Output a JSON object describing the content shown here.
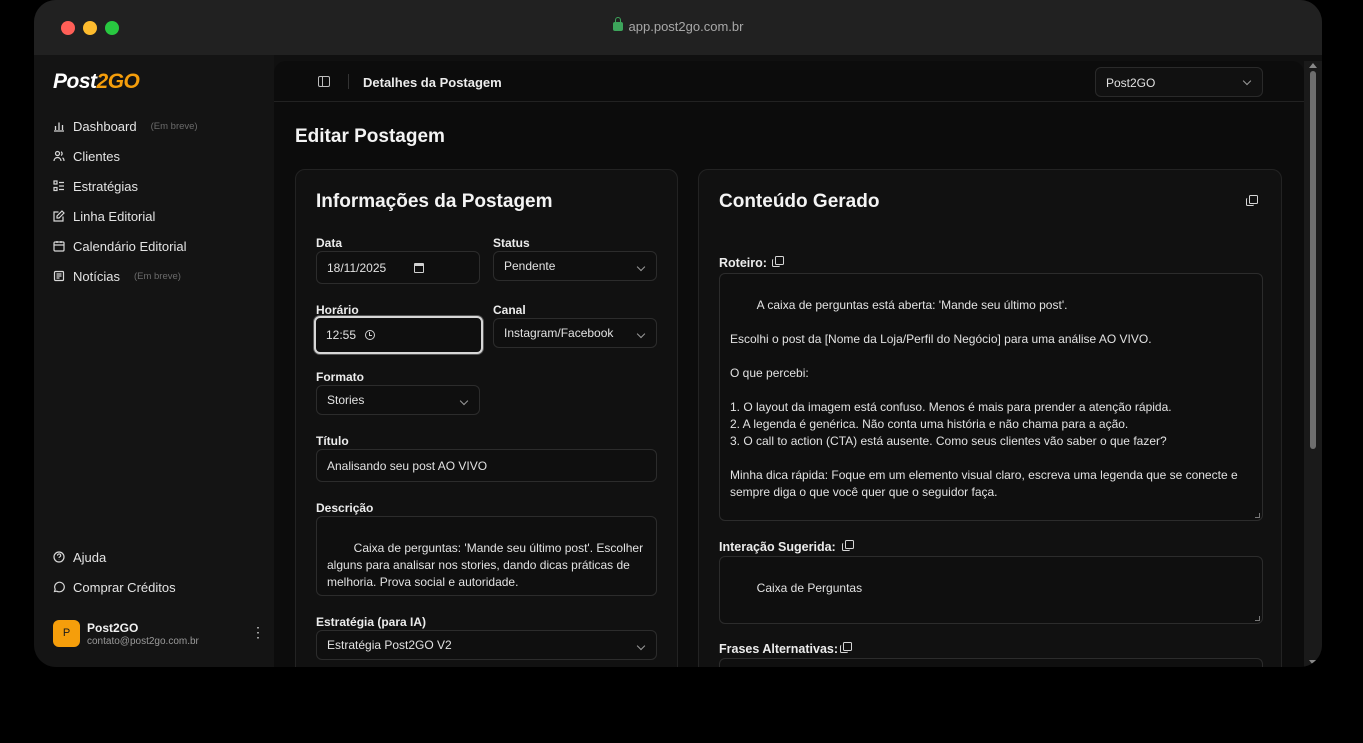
{
  "browser": {
    "url": "app.post2go.com.br"
  },
  "sidebar": {
    "logo_post": "Post",
    "logo_go": "2GO",
    "items": [
      {
        "label": "Dashboard",
        "badge": "(Em breve)"
      },
      {
        "label": "Clientes"
      },
      {
        "label": "Estratégias"
      },
      {
        "label": "Linha Editorial"
      },
      {
        "label": "Calendário Editorial"
      },
      {
        "label": "Notícias",
        "badge": "(Em breve)"
      }
    ],
    "bottom_items": [
      {
        "label": "Ajuda"
      },
      {
        "label": "Comprar Créditos"
      }
    ],
    "user": {
      "initial": "P",
      "name": "Post2GO",
      "email": "contato@post2go.com.br"
    }
  },
  "topbar": {
    "breadcrumb": "Detalhes da Postagem",
    "workspace": "Post2GO"
  },
  "page": {
    "title": "Editar Postagem"
  },
  "form": {
    "title": "Informações da Postagem",
    "date_label": "Data",
    "date_value": "18/11/2025",
    "status_label": "Status",
    "status_value": "Pendente",
    "time_label": "Horário",
    "time_value": "12:55",
    "channel_label": "Canal",
    "channel_value": "Instagram/Facebook",
    "format_label": "Formato",
    "format_value": "Stories",
    "title_label": "Título",
    "title_value": "Analisando seu post AO VIVO",
    "description_label": "Descrição",
    "description_value": "Caixa de perguntas: 'Mande seu último post'. Escolher alguns para analisar nos stories, dando dicas práticas de melhoria. Prova social e autoridade.",
    "strategy_label": "Estratégia (para IA)",
    "strategy_value": "Estratégia Post2GO V2"
  },
  "generated": {
    "title": "Conteúdo Gerado",
    "script_label": "Roteiro:",
    "script_value": "A caixa de perguntas está aberta: 'Mande seu último post'.\n\nEscolhi o post da [Nome da Loja/Perfil do Negócio] para uma análise AO VIVO.\n\nO que percebi:\n\n1. O layout da imagem está confuso. Menos é mais para prender a atenção rápida.\n2. A legenda é genérica. Não conta uma história e não chama para a ação.\n3. O call to action (CTA) está ausente. Como seus clientes vão saber o que fazer?\n\nMinha dica rápida: Foque em um elemento visual claro, escreva uma legenda que se conecte e sempre diga o que você quer que o seguidor faça.\n\nQuer ver seu post analisado na próxima? Mande seu último post agora na caixa de perguntas!",
    "interaction_label": "Interação Sugerida:",
    "interaction_value": "Caixa de Perguntas",
    "alt_phrases_label": "Frases Alternativas:"
  }
}
